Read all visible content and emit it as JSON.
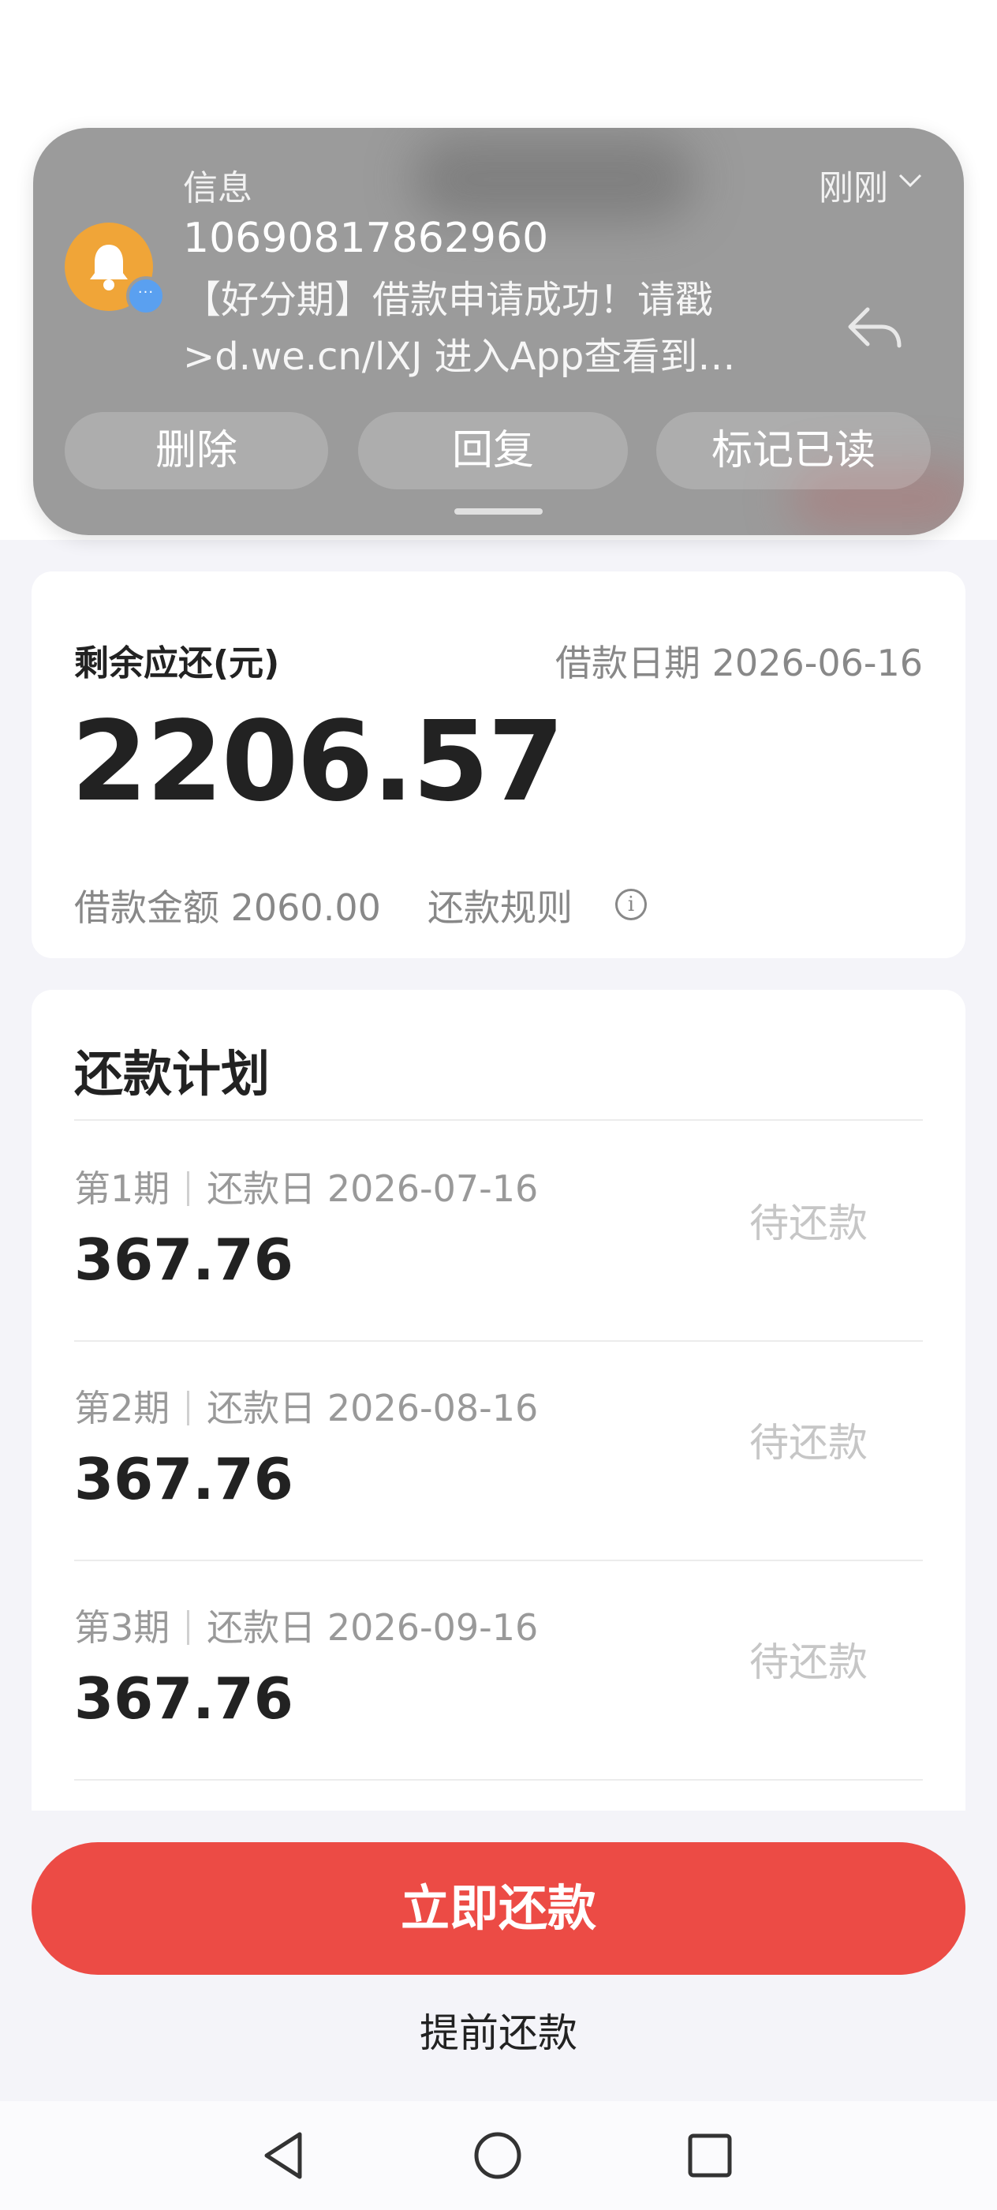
{
  "notification": {
    "app_name": "信息",
    "time": "刚刚",
    "sender": "10690817862960",
    "line1": "【好分期】借款申请成功！请戳",
    "line2": ">d.we.cn/lXJ 进入App查看到…",
    "actions": [
      "删除",
      "回复",
      "标记已读"
    ]
  },
  "summary": {
    "remaining_label": "剩余应还(元)",
    "loan_date_label": "借款日期",
    "loan_date": "2026-06-16",
    "remaining_amount": "2206.57",
    "loan_amount_label": "借款金额",
    "loan_amount": "2060.00",
    "rules_label": "还款规则"
  },
  "plan": {
    "title": "还款计划",
    "due_label": "还款日",
    "items": [
      {
        "period": "第1期",
        "date": "2026-07-16",
        "amount": "367.76",
        "status": "待还款"
      },
      {
        "period": "第2期",
        "date": "2026-08-16",
        "amount": "367.76",
        "status": "待还款"
      },
      {
        "period": "第3期",
        "date": "2026-09-16",
        "amount": "367.76",
        "status": "待还款"
      }
    ]
  },
  "actions": {
    "pay_now": "立即还款",
    "prepay": "提前还款"
  },
  "colors": {
    "accent": "#ec4b45",
    "background": "#f4f4f9",
    "notification_bg": "#9b9b9b",
    "avatar": "#f0a538"
  }
}
